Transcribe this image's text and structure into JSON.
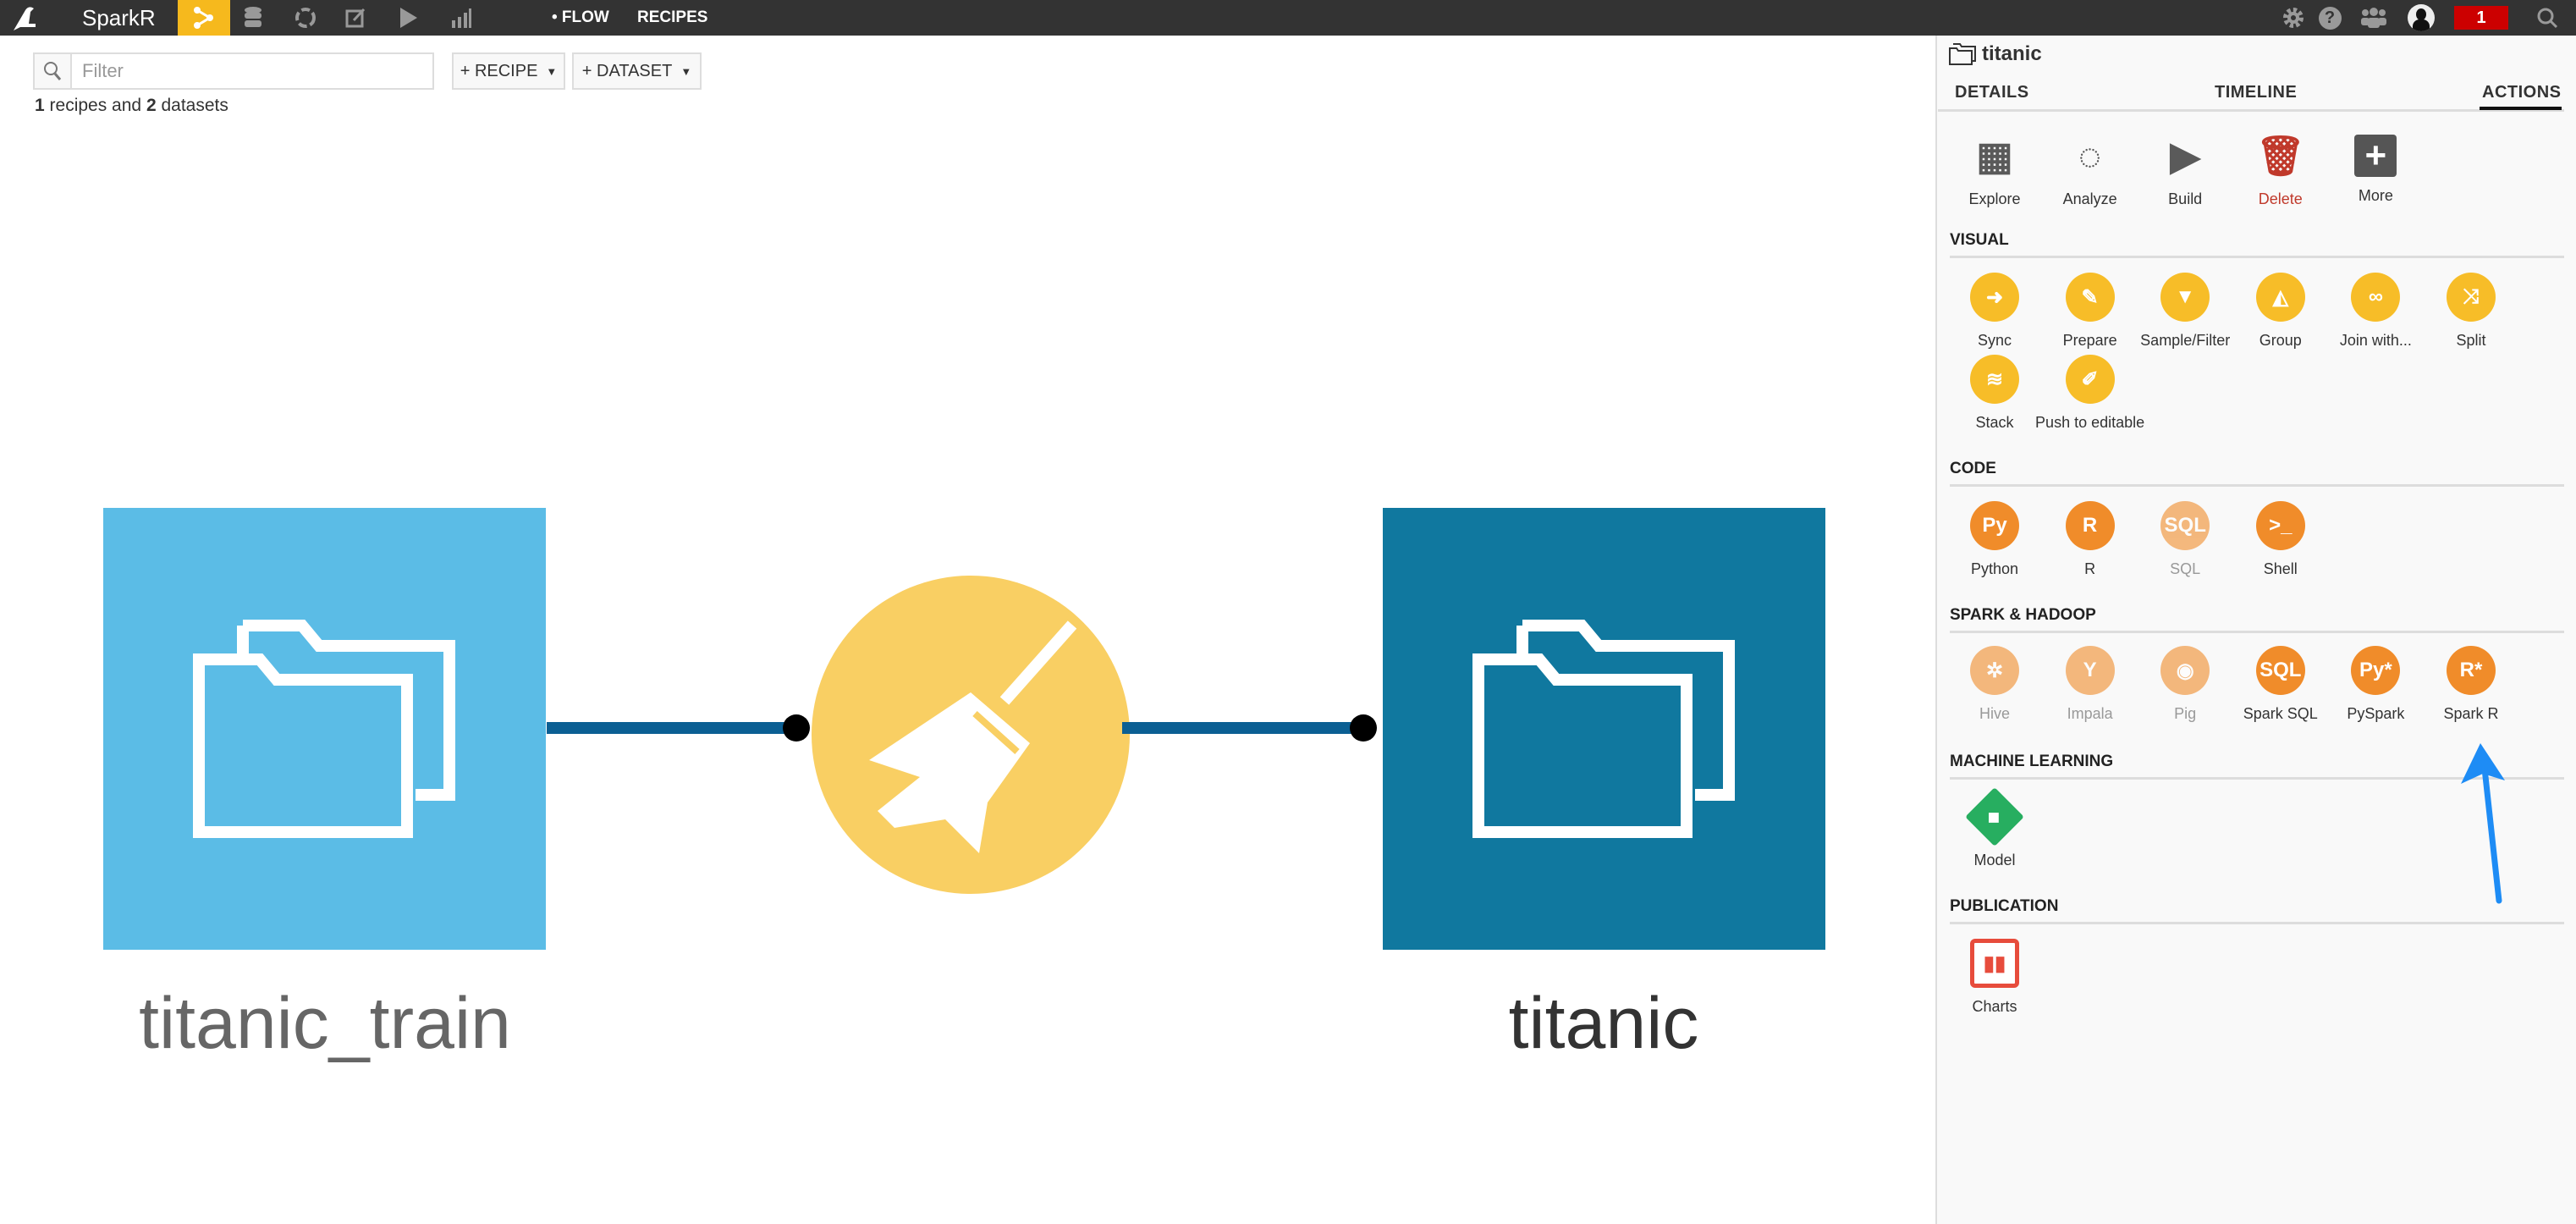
{
  "topbar": {
    "app_name": "SparkR",
    "nav_icons": [
      "flow-icon",
      "datasets-icon",
      "analysis-icon",
      "notebook-icon",
      "jobs-icon",
      "dashboard-icon"
    ],
    "flow_label": "• FLOW",
    "recipes_label": "RECIPES",
    "notification_count": "1",
    "right_icons": [
      "gear-icon",
      "help-icon",
      "users-icon",
      "avatar",
      "search-icon"
    ]
  },
  "toolbar": {
    "filter_placeholder": "Filter",
    "filter_value": "",
    "recipe_button": "+ RECIPE",
    "dataset_button": "+ DATASET",
    "summary_recipes": "1",
    "summary_mid": " recipes and ",
    "summary_datasets": "2",
    "summary_end": " datasets"
  },
  "flow": {
    "source_dataset": "titanic_train",
    "target_dataset": "titanic",
    "recipe_type": "prepare",
    "colors": {
      "source": "#5bbce6",
      "target": "#10789f",
      "recipe": "#f9cf63",
      "link": "#0b5f93"
    }
  },
  "panel": {
    "title": "titanic",
    "tabs": [
      "DETAILS",
      "TIMELINE",
      "ACTIONS"
    ],
    "active_tab": "ACTIONS",
    "actions": [
      {
        "label": "Explore",
        "icon": "table-icon"
      },
      {
        "label": "Analyze",
        "icon": "analyze-icon"
      },
      {
        "label": "Build",
        "icon": "play-icon"
      },
      {
        "label": "Delete",
        "icon": "trash-icon"
      },
      {
        "label": "More",
        "icon": "plus-circle-icon"
      }
    ],
    "sections": [
      {
        "title": "VISUAL",
        "color": "#f7bd28",
        "items": [
          {
            "label": "Sync",
            "icon": "sync-icon"
          },
          {
            "label": "Prepare",
            "icon": "broom-icon"
          },
          {
            "label": "Sample/Filter",
            "icon": "filter-icon"
          },
          {
            "label": "Group",
            "icon": "group-icon"
          },
          {
            "label": "Join with...",
            "icon": "join-icon"
          },
          {
            "label": "Split",
            "icon": "split-icon"
          },
          {
            "label": "Stack",
            "icon": "stack-icon"
          },
          {
            "label": "Push to editable",
            "icon": "push-icon"
          }
        ]
      },
      {
        "title": "CODE",
        "color": "#f08c2a",
        "items": [
          {
            "label": "Python",
            "icon": "python-icon"
          },
          {
            "label": "R",
            "icon": "r-icon"
          },
          {
            "label": "SQL",
            "icon": "sql-icon",
            "disabled": true
          },
          {
            "label": "Shell",
            "icon": "shell-icon"
          }
        ]
      },
      {
        "title": "SPARK & HADOOP",
        "color": "#f08c2a",
        "items": [
          {
            "label": "Hive",
            "icon": "hive-icon",
            "disabled": true
          },
          {
            "label": "Impala",
            "icon": "impala-icon",
            "disabled": true
          },
          {
            "label": "Pig",
            "icon": "pig-icon",
            "disabled": true
          },
          {
            "label": "Spark SQL",
            "icon": "spark-sql-icon"
          },
          {
            "label": "PySpark",
            "icon": "pyspark-icon"
          },
          {
            "label": "Spark R",
            "icon": "spark-r-icon"
          }
        ]
      },
      {
        "title": "MACHINE LEARNING",
        "color": "#27ae60",
        "items": [
          {
            "label": "Model",
            "icon": "model-icon"
          }
        ]
      },
      {
        "title": "PUBLICATION",
        "color": "#e74c3c",
        "items": [
          {
            "label": "Charts",
            "icon": "charts-icon"
          }
        ]
      }
    ],
    "delete_color": "#c0392b",
    "annotation_arrow_color": "#1e8cf5"
  }
}
